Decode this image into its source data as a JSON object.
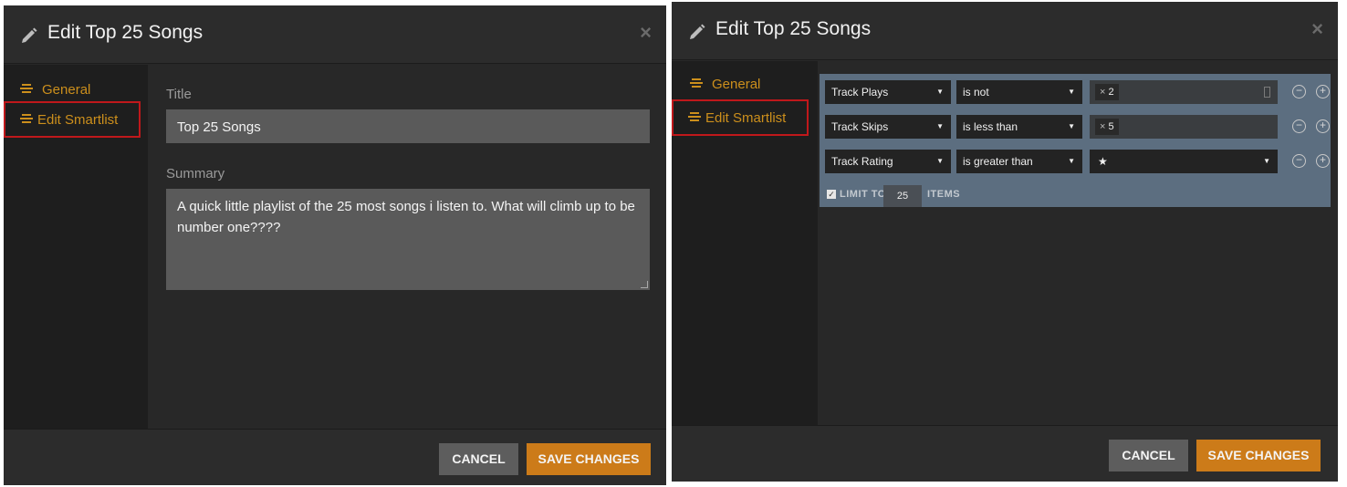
{
  "dialog_title": "Edit Top 25 Songs",
  "close_glyph": "×",
  "nav": {
    "general": "General",
    "edit_smartlist": "Edit Smartlist"
  },
  "general_form": {
    "title_label": "Title",
    "title_value": "Top 25 Songs",
    "summary_label": "Summary",
    "summary_value": "A quick little playlist of the 25 most songs i listen to. What will climb up to be number one????"
  },
  "smartlist": {
    "rules": [
      {
        "field": "Track Plays",
        "operator": "is not",
        "value": "2",
        "value_type": "chip"
      },
      {
        "field": "Track Skips",
        "operator": "is less than",
        "value": "5",
        "value_type": "chip"
      },
      {
        "field": "Track Rating",
        "operator": "is greater than",
        "value": "★",
        "value_type": "select"
      }
    ],
    "limit_checked": true,
    "limit_label": "LIMIT TO",
    "limit_value": "25",
    "limit_suffix": "ITEMS"
  },
  "footer": {
    "cancel_label": "CANCEL",
    "save_label": "SAVE CHANGES"
  },
  "colors": {
    "accent": "#cc8f1c",
    "save_button": "#cc7b19",
    "highlight_border": "#c0181b",
    "rules_panel": "#5c6e80",
    "dialog_bg": "#282828"
  }
}
